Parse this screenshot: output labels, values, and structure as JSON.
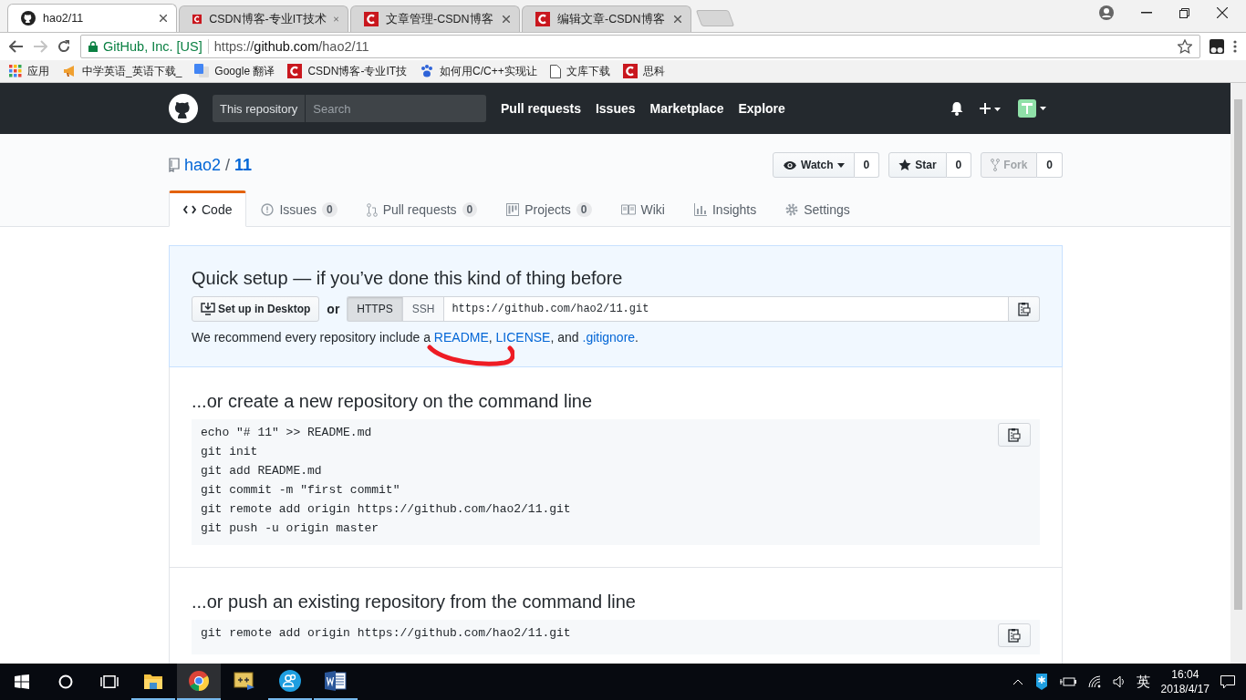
{
  "browser": {
    "tabs": [
      {
        "title": "hao2/11",
        "kind": "github",
        "selected": true
      },
      {
        "title": "CSDN博客-专业IT技术",
        "kind": "csdn",
        "selected": false
      },
      {
        "title": "文章管理-CSDN博客",
        "kind": "csdn",
        "selected": false
      },
      {
        "title": "编辑文章-CSDN博客",
        "kind": "csdn",
        "selected": false
      }
    ],
    "address": {
      "security_label": "GitHub, Inc. [US]",
      "url_scheme": "https://",
      "url_host": "github.com",
      "url_path": "/hao2/11"
    },
    "bookmarks": [
      {
        "label": "应用",
        "kind": "apps"
      },
      {
        "label": "中学英语_英语下载_",
        "kind": "horn"
      },
      {
        "label": "Google 翻译",
        "kind": "translate"
      },
      {
        "label": "CSDN博客-专业IT技",
        "kind": "csdn"
      },
      {
        "label": "如何用C/C++实现让",
        "kind": "paw"
      },
      {
        "label": "文库下载",
        "kind": "page"
      },
      {
        "label": "思科",
        "kind": "csdn"
      }
    ]
  },
  "github_header": {
    "search_scope": "This repository",
    "search_placeholder": "Search",
    "nav": [
      "Pull requests",
      "Issues",
      "Marketplace",
      "Explore"
    ]
  },
  "repo": {
    "owner": "hao2",
    "separator": "/",
    "name": "11",
    "actions": [
      {
        "kind": "watch",
        "label": "Watch",
        "count": "0",
        "disabled": false
      },
      {
        "kind": "star",
        "label": "Star",
        "count": "0",
        "disabled": false
      },
      {
        "kind": "fork",
        "label": "Fork",
        "count": "0",
        "disabled": true
      }
    ],
    "tabs": [
      {
        "kind": "code",
        "label": "Code",
        "selected": true
      },
      {
        "kind": "issues",
        "label": "Issues",
        "count": "0",
        "selected": false
      },
      {
        "kind": "pr",
        "label": "Pull requests",
        "count": "0",
        "selected": false
      },
      {
        "kind": "projects",
        "label": "Projects",
        "count": "0",
        "selected": false
      },
      {
        "kind": "wiki",
        "label": "Wiki",
        "selected": false
      },
      {
        "kind": "insights",
        "label": "Insights",
        "selected": false
      },
      {
        "kind": "settings",
        "label": "Settings",
        "selected": false
      }
    ]
  },
  "quick_setup": {
    "title": "Quick setup — if you’ve done this kind of thing before",
    "desktop_button": "Set up in Desktop",
    "or": "or",
    "protocols": [
      {
        "label": "HTTPS",
        "selected": true
      },
      {
        "label": "SSH",
        "selected": false
      }
    ],
    "clone_url": "https://github.com/hao2/11.git",
    "recommend": [
      {
        "kind": "text",
        "text": "We recommend every repository include a "
      },
      {
        "kind": "link",
        "text": "README"
      },
      {
        "kind": "text",
        "text": ", "
      },
      {
        "kind": "link",
        "text": "LICENSE"
      },
      {
        "kind": "text",
        "text": ", and "
      },
      {
        "kind": "link",
        "text": ".gitignore"
      },
      {
        "kind": "text",
        "text": "."
      }
    ]
  },
  "sections": [
    {
      "title": "...or create a new repository on the command line",
      "code": [
        "echo \"# 11\" >> README.md",
        "git init",
        "git add README.md",
        "git commit -m \"first commit\"",
        "git remote add origin https://github.com/hao2/11.git",
        "git push -u origin master"
      ]
    },
    {
      "title": "...or push an existing repository from the command line",
      "code": [
        "git remote add origin https://github.com/hao2/11.git"
      ]
    }
  ],
  "taskbar": {
    "apps": [
      {
        "kind": "explorer",
        "running": true,
        "selected": false
      },
      {
        "kind": "chrome",
        "running": true,
        "selected": true
      },
      {
        "kind": "editor",
        "running": false,
        "selected": false
      },
      {
        "kind": "contacts",
        "running": true,
        "selected": false
      },
      {
        "kind": "word",
        "running": true,
        "selected": false
      }
    ],
    "ime": "英",
    "time": "16:04",
    "date": "2018/4/17"
  }
}
